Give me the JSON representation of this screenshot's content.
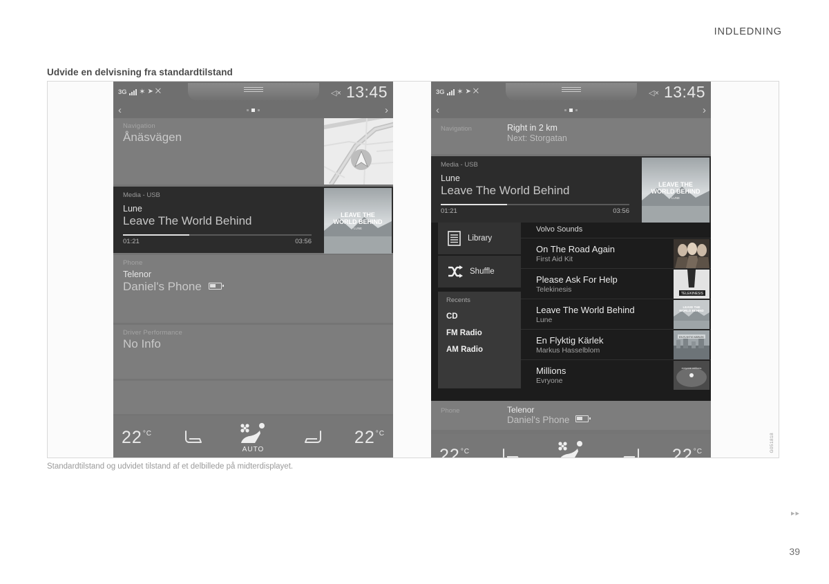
{
  "header": {
    "running_title": "INDLEDNING"
  },
  "section": {
    "title": "Udvide en delvisning fra standardtilstand"
  },
  "caption": "Standardtilstand og udvidet tilstand af et delbillede på midterdisplayet.",
  "figure_id": "G051818",
  "footer": {
    "arrows": "▸▸",
    "page_number": "39"
  },
  "statusbar": {
    "network": "3G",
    "icons": [
      "signal-bars-icon",
      "bluetooth-icon",
      "navigation-arrow-icon",
      "no-connection-icon"
    ],
    "bluetooth_glyph": "✶",
    "nav_glyph": "➤",
    "crossed_glyph": "⨉",
    "mute_glyph": "◁×",
    "clock": "13:45"
  },
  "pager": {
    "prev_glyph": "‹",
    "next_glyph": "›",
    "dots": 3,
    "active_dot_index": 1
  },
  "left_screen": {
    "navigation": {
      "label": "Navigation",
      "street": "Ånäsvägen"
    },
    "media": {
      "label": "Media - USB",
      "artist": "Lune",
      "title": "Leave The World Behind",
      "elapsed": "01:21",
      "duration": "03:56",
      "progress_percent": 35,
      "album_art_line1": "LEAVE THE",
      "album_art_line2": "WORLD BEHIND",
      "album_art_line3": "LUNE"
    },
    "phone": {
      "label": "Phone",
      "carrier": "Telenor",
      "device": "Daniel's Phone",
      "battery_icon": "battery-icon"
    },
    "driver_performance": {
      "label": "Driver Performance",
      "value": "No Info"
    }
  },
  "right_screen": {
    "navigation": {
      "label": "Navigation",
      "instruction": "Right in 2 km",
      "next": "Next: Storgatan"
    },
    "media": {
      "label": "Media - USB",
      "artist": "Lune",
      "title": "Leave The World Behind",
      "elapsed": "01:21",
      "duration": "03:56",
      "progress_percent": 35,
      "album_art_line1": "LEAVE THE",
      "album_art_line2": "WORLD BEHIND",
      "album_art_line3": "LUNE"
    },
    "expanded": {
      "source_title": "Volvo Sounds",
      "library_button": "Library",
      "shuffle_button": "Shuffle",
      "library_icon": "list-icon",
      "shuffle_icon": "shuffle-icon",
      "recents_label": "Recents",
      "recents": [
        {
          "label": "CD"
        },
        {
          "label": "FM Radio"
        },
        {
          "label": "AM Radio"
        }
      ],
      "tracks": [
        {
          "title": "On The Road Again",
          "artist": "First Aid Kit",
          "art": "band-photo"
        },
        {
          "title": "Please Ask For Help",
          "artist": "Telekinesis",
          "art": "telekinesis"
        },
        {
          "title": "Leave The World Behind",
          "artist": "Lune",
          "art": "lake"
        },
        {
          "title": "En Flyktig Kärlek",
          "artist": "Markus Hasselblom",
          "art": "city"
        },
        {
          "title": "Millions",
          "artist": "Evryone",
          "art": "evryone"
        }
      ]
    },
    "phone": {
      "label": "Phone",
      "carrier": "Telenor",
      "device": "Daniel's Phone",
      "battery_icon": "battery-icon"
    }
  },
  "climate": {
    "left_temp": "22",
    "right_temp": "22",
    "unit": "°C",
    "auto_label": "AUTO",
    "left_seat_icon": "seat-icon",
    "right_seat_icon": "seat-icon",
    "center_icon": "fan-seat-auto-icon"
  },
  "colors": {
    "screen_bg": "#757575",
    "tile_bg": "#7d7d7d",
    "media_bg": "#2c2c2c",
    "expand_bg": "#1c1c1c",
    "text_primary": "#ececec",
    "text_secondary": "#a4a4a4"
  }
}
